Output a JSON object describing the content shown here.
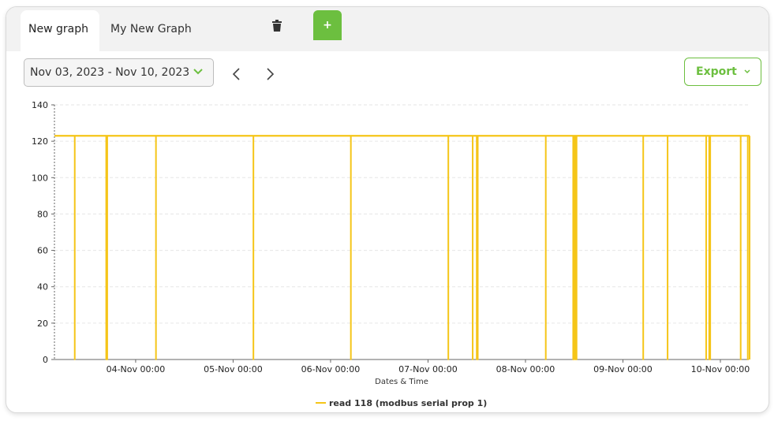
{
  "tabs": [
    {
      "label": "New graph",
      "active": true
    },
    {
      "label": "My New Graph",
      "active": false
    }
  ],
  "add_tab_label": "+",
  "date_range": {
    "label": "Nov 03, 2023 - Nov 10, 2023"
  },
  "export": {
    "label": "Export"
  },
  "colors": {
    "accent": "#6cbf3f",
    "series": "#f5c518",
    "grid": "#e6e6e6"
  },
  "icons": {
    "trash": "trash-icon",
    "prev": "chevron-left-icon",
    "next": "chevron-right-icon",
    "dropdown": "chevron-down-icon"
  },
  "chart_data": {
    "type": "line",
    "title": "",
    "xlabel": "Dates & Time",
    "ylabel": "",
    "ylim": [
      0,
      140
    ],
    "yticks": [
      0,
      20,
      40,
      60,
      80,
      100,
      120,
      140
    ],
    "xlim": [
      "2023-11-03 04:00",
      "2023-11-10 07:00"
    ],
    "xtick_labels": [
      "04-Nov 00:00",
      "05-Nov 00:00",
      "06-Nov 00:00",
      "07-Nov 00:00",
      "08-Nov 00:00",
      "09-Nov 00:00",
      "10-Nov 00:00"
    ],
    "xtick_values": [
      "2023-11-04 00:00",
      "2023-11-05 00:00",
      "2023-11-06 00:00",
      "2023-11-07 00:00",
      "2023-11-08 00:00",
      "2023-11-09 00:00",
      "2023-11-10 00:00"
    ],
    "grid": true,
    "legend": "bottom-center",
    "series": [
      {
        "name": "read 118 (modbus serial prop 1)",
        "color": "#f5c518",
        "baseline_value": 123,
        "drop_value": 0,
        "drops_to_zero_at": [
          "2023-11-03 09:00",
          "2023-11-03 16:45",
          "2023-11-03 17:00",
          "2023-11-04 05:00",
          "2023-11-05 05:00",
          "2023-11-06 05:00",
          "2023-11-07 05:00",
          "2023-11-07 11:00",
          "2023-11-07 12:00",
          "2023-11-07 12:15",
          "2023-11-08 05:00",
          "2023-11-08 11:45",
          "2023-11-08 12:00",
          "2023-11-08 12:20",
          "2023-11-08 12:35",
          "2023-11-09 05:00",
          "2023-11-09 11:00",
          "2023-11-09 20:30",
          "2023-11-09 21:15",
          "2023-11-09 21:30",
          "2023-11-10 05:00",
          "2023-11-10 06:45"
        ]
      }
    ]
  }
}
